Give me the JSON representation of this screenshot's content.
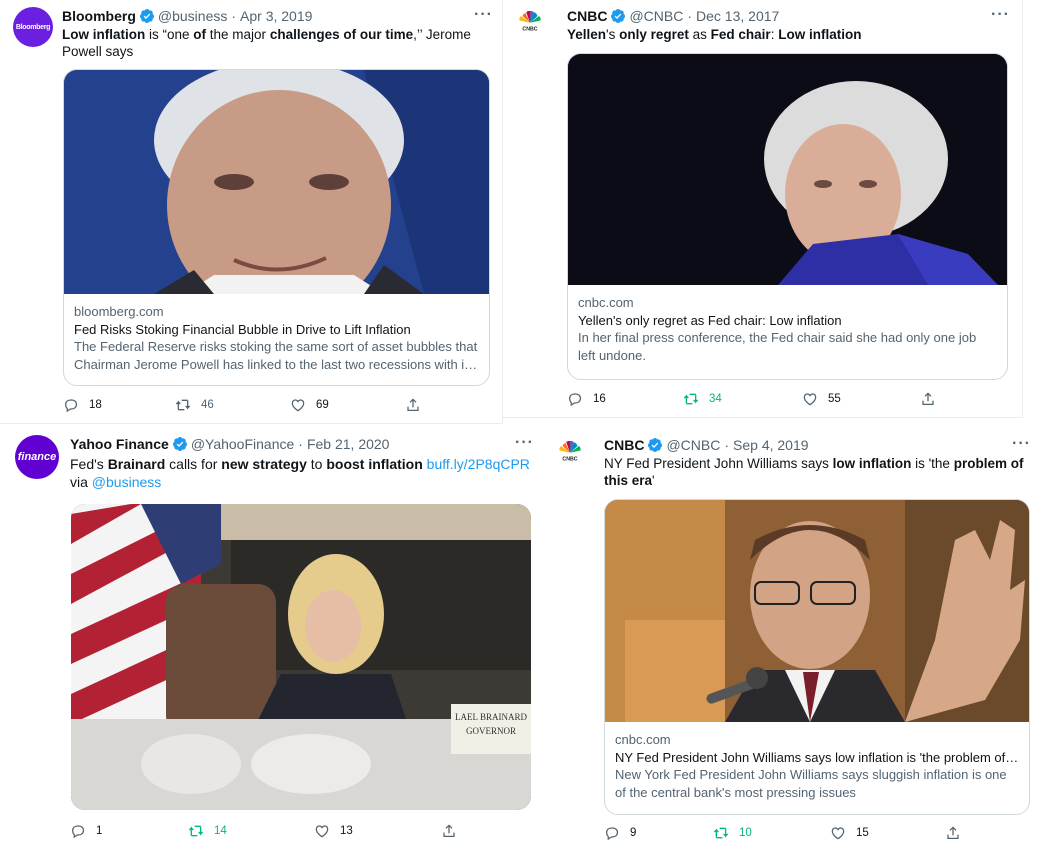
{
  "tweets": [
    {
      "name": "Bloomberg",
      "handle": "@business",
      "date": "Apr 3, 2019",
      "avatar_text": "Bloomberg",
      "text": {
        "p1": "Low inflation",
        "p2": " is “one ",
        "p3": "of",
        "p4": " the major ",
        "p5": "challenges of our time",
        "p6": ",’’ Jerome Powell says"
      },
      "card": {
        "domain": "bloomberg.com",
        "title": "Fed Risks Stoking Financial Bubble in Drive to Lift Inflation",
        "description": "The Federal Reserve risks stoking the same sort of asset bubbles that Chairman Jerome Powell has linked to the last two recessions with its ..."
      },
      "stats": {
        "replies": "18",
        "retweets": "46",
        "likes": "69"
      }
    },
    {
      "name": "CNBC",
      "handle": "@CNBC",
      "date": "Dec 13, 2017",
      "text": {
        "p1": "Yellen",
        "p2": "'s ",
        "p3": "only regret",
        "p4": " as ",
        "p5": "Fed chair",
        "p6": ": ",
        "p7": "Low inflation"
      },
      "card": {
        "domain": "cnbc.com",
        "title": "Yellen's only regret as Fed chair: Low inflation",
        "description": "In her final press conference, the Fed chair said she had only one job left undone."
      },
      "stats": {
        "replies": "16",
        "retweets": "34",
        "likes": "55"
      }
    },
    {
      "name": "Yahoo Finance",
      "handle": "@YahooFinance",
      "date": "Feb 21, 2020",
      "avatar_text": "finance",
      "text": {
        "p1": "Fed's ",
        "p2": "Brainard",
        "p3": " calls for ",
        "p4": "new strategy",
        "p5": " to ",
        "p6": "boost inflation",
        "p7": " ",
        "link": "buff.ly/2P8qCPR",
        "p8": " via ",
        "mention": "@business"
      },
      "stats": {
        "replies": "1",
        "retweets": "14",
        "likes": "13"
      }
    },
    {
      "name": "CNBC",
      "handle": "@CNBC",
      "date": "Sep 4, 2019",
      "text": {
        "p1": "NY Fed President John Williams says ",
        "p2": "low inflation",
        "p3": " is 'the ",
        "p4": "problem of this era",
        "p5": "'"
      },
      "card": {
        "domain": "cnbc.com",
        "title": "NY Fed President John Williams says low inflation is 'the problem of th...",
        "description": "New York Fed President John Williams says sluggish inflation is one of the central bank's most pressing issues"
      },
      "stats": {
        "replies": "9",
        "retweets": "10",
        "likes": "15"
      }
    }
  ],
  "more_label": "···",
  "separator": "·",
  "colors": {
    "text": "#0f1419",
    "secondary": "#536471",
    "link": "#1d9bf0",
    "retweet_green": "#00ba7c",
    "verified": "#1d9bf0"
  }
}
